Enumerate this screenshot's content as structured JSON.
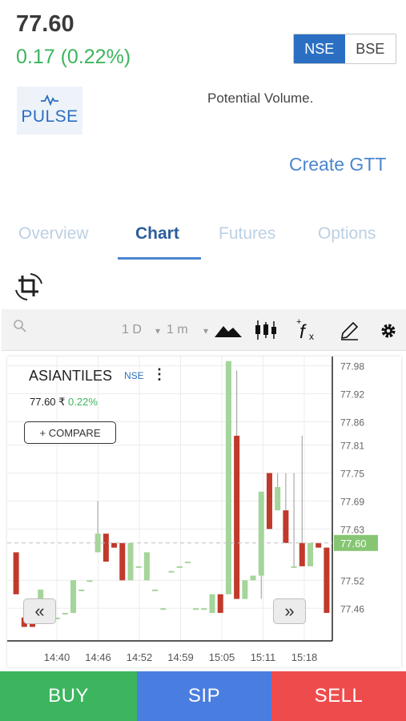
{
  "quote": {
    "price": "77.60",
    "change": "0.17 (0.22%)"
  },
  "exchange_toggle": {
    "options": [
      "NSE",
      "BSE"
    ],
    "selected": "NSE"
  },
  "pulse": {
    "label": "PULSE",
    "icon": "pulse-icon"
  },
  "potential_volume": "Potential Volume.",
  "create_gtt": "Create GTT",
  "tabs": [
    "Overview",
    "Chart",
    "Futures",
    "Options"
  ],
  "active_tab": "Chart",
  "toolbar": {
    "interval_1": "1 D",
    "interval_2": "1 m",
    "icons": [
      "search-icon",
      "mountain-chart-icon",
      "candlestick-icon",
      "fx-icon",
      "draw-icon",
      "gear-icon"
    ]
  },
  "chart_header": {
    "symbol": "ASIANTILES",
    "exchange": "NSE",
    "price": "77.60 ₹",
    "pct": "0.22%",
    "compare_label": "+ COMPARE"
  },
  "chart_data": {
    "type": "candlestick",
    "x_ticks": [
      "14:40",
      "14:46",
      "14:52",
      "14:59",
      "15:05",
      "15:11",
      "15:18"
    ],
    "y_ticks": [
      77.98,
      77.92,
      77.86,
      77.81,
      77.75,
      77.69,
      77.63,
      77.52,
      77.46
    ],
    "ylim": [
      77.39,
      78.0
    ],
    "last_price_label": "77.60",
    "grid": true,
    "colors": {
      "up": "#a4d59a",
      "down": "#c0392b",
      "last": "#86c673"
    },
    "candles": [
      {
        "o": 77.58,
        "h": 77.58,
        "l": 77.49,
        "c": 77.49
      },
      {
        "o": 77.44,
        "h": 77.47,
        "l": 77.42,
        "c": 77.42
      },
      {
        "o": 77.44,
        "h": 77.48,
        "l": 77.42,
        "c": 77.42
      },
      {
        "o": 77.46,
        "h": 77.5,
        "l": 77.43,
        "c": 77.5
      },
      {
        "o": 77.44,
        "h": 77.44,
        "l": 77.44,
        "c": 77.44
      },
      {
        "o": 77.44,
        "h": 77.44,
        "l": 77.44,
        "c": 77.44
      },
      {
        "o": 77.45,
        "h": 77.45,
        "l": 77.45,
        "c": 77.45
      },
      {
        "o": 77.45,
        "h": 77.52,
        "l": 77.45,
        "c": 77.52
      },
      {
        "o": 77.5,
        "h": 77.5,
        "l": 77.5,
        "c": 77.5
      },
      {
        "o": 77.52,
        "h": 77.52,
        "l": 77.52,
        "c": 77.52
      },
      {
        "o": 77.58,
        "h": 77.69,
        "l": 77.58,
        "c": 77.62
      },
      {
        "o": 77.62,
        "h": 77.62,
        "l": 77.56,
        "c": 77.56
      },
      {
        "o": 77.6,
        "h": 77.6,
        "l": 77.59,
        "c": 77.59
      },
      {
        "o": 77.6,
        "h": 77.6,
        "l": 77.52,
        "c": 77.52
      },
      {
        "o": 77.52,
        "h": 77.6,
        "l": 77.52,
        "c": 77.6
      },
      {
        "o": 77.55,
        "h": 77.55,
        "l": 77.55,
        "c": 77.55
      },
      {
        "o": 77.52,
        "h": 77.58,
        "l": 77.52,
        "c": 77.58
      },
      {
        "o": 77.5,
        "h": 77.5,
        "l": 77.5,
        "c": 77.5
      },
      {
        "o": 77.46,
        "h": 77.46,
        "l": 77.46,
        "c": 77.46
      },
      {
        "o": 77.54,
        "h": 77.54,
        "l": 77.54,
        "c": 77.54
      },
      {
        "o": 77.55,
        "h": 77.55,
        "l": 77.55,
        "c": 77.55
      },
      {
        "o": 77.56,
        "h": 77.56,
        "l": 77.56,
        "c": 77.56
      },
      {
        "o": 77.46,
        "h": 77.46,
        "l": 77.46,
        "c": 77.46
      },
      {
        "o": 77.46,
        "h": 77.46,
        "l": 77.46,
        "c": 77.46
      },
      {
        "o": 77.45,
        "h": 77.49,
        "l": 77.45,
        "c": 77.49
      },
      {
        "o": 77.49,
        "h": 77.49,
        "l": 77.45,
        "c": 77.45
      },
      {
        "o": 77.49,
        "h": 77.99,
        "l": 77.49,
        "c": 77.99
      },
      {
        "o": 77.83,
        "h": 77.97,
        "l": 77.48,
        "c": 77.48
      },
      {
        "o": 77.48,
        "h": 77.52,
        "l": 77.48,
        "c": 77.52
      },
      {
        "o": 77.52,
        "h": 77.53,
        "l": 77.52,
        "c": 77.53
      },
      {
        "o": 77.53,
        "h": 77.71,
        "l": 77.48,
        "c": 77.71
      },
      {
        "o": 77.75,
        "h": 77.75,
        "l": 77.63,
        "c": 77.63
      },
      {
        "o": 77.67,
        "h": 77.75,
        "l": 77.67,
        "c": 77.72
      },
      {
        "o": 77.67,
        "h": 77.75,
        "l": 77.6,
        "c": 77.6
      },
      {
        "o": 77.55,
        "h": 77.75,
        "l": 77.55,
        "c": 77.55
      },
      {
        "o": 77.6,
        "h": 77.83,
        "l": 77.6,
        "c": 77.55
      },
      {
        "o": 77.55,
        "h": 77.6,
        "l": 77.55,
        "c": 77.6
      },
      {
        "o": 77.6,
        "h": 77.6,
        "l": 77.59,
        "c": 77.59
      },
      {
        "o": 77.59,
        "h": 77.59,
        "l": 77.45,
        "c": 77.45
      }
    ]
  },
  "actions": [
    {
      "label": "BUY",
      "color": "#3cb55e"
    },
    {
      "label": "SIP",
      "color": "#4a7de0"
    },
    {
      "label": "SELL",
      "color": "#ee4c4c"
    }
  ]
}
